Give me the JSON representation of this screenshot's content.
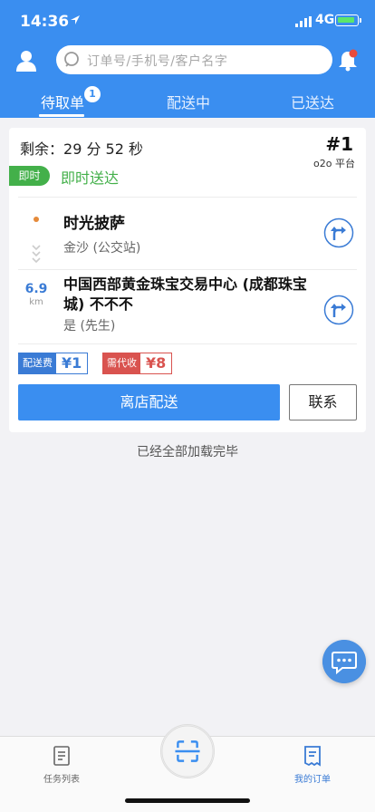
{
  "status_bar": {
    "time": "14:36",
    "network": "4G"
  },
  "search": {
    "placeholder": "订单号/手机号/客户名字"
  },
  "tabs": [
    {
      "label": "待取单",
      "badge": "1"
    },
    {
      "label": "配送中"
    },
    {
      "label": "已送达"
    }
  ],
  "order": {
    "remaining_label": "剩余：",
    "remaining_time": "29 分 52 秒",
    "order_number": "#1",
    "platform": "o2o 平台",
    "tag": "即时",
    "delivery_type": "即时送达",
    "shop_name": "时光披萨",
    "shop_address": "金沙 (公交站)",
    "distance_value": "6.9",
    "distance_unit": "km",
    "destination": "中国西部黄金珠宝交易中心 (成都珠宝城) 不不不",
    "customer": "是 (先生)",
    "delivery_fee_label": "配送费",
    "delivery_fee_value": "¥1",
    "collect_label": "需代收",
    "collect_value": "¥8",
    "primary_action": "离店配送",
    "secondary_action": "联系"
  },
  "list_end_text": "已经全部加载完毕",
  "bottom_nav": {
    "left_label": "任务列表",
    "right_label": "我的订单"
  },
  "colors": {
    "brand_blue": "#3a8ef0",
    "instant_green": "#43b04a",
    "fee_blue": "#3a7bd5",
    "collect_red": "#d9534f",
    "distance_orange": "#e58a3a"
  }
}
